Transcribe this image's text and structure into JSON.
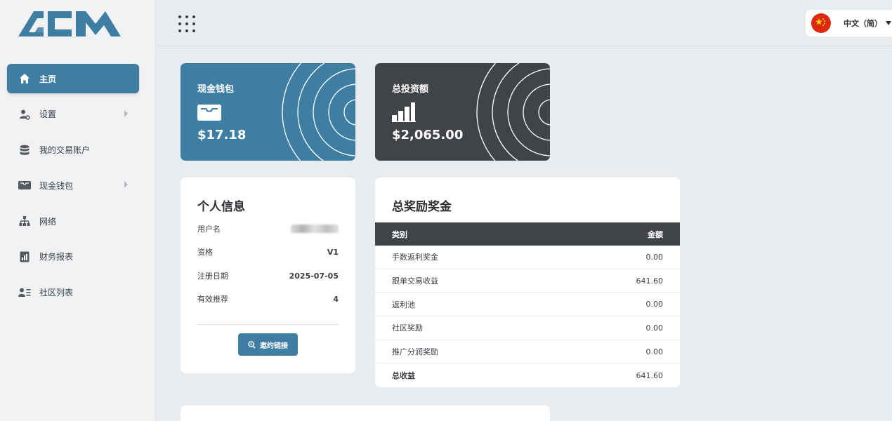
{
  "brand": {
    "logo_text": "ACM"
  },
  "sidebar": {
    "items": [
      {
        "label": "主页",
        "icon": "home-icon",
        "active": true,
        "submenu": false
      },
      {
        "label": "设置",
        "icon": "user-gear-icon",
        "active": false,
        "submenu": true
      },
      {
        "label": "我的交易账户",
        "icon": "database-icon",
        "active": false,
        "submenu": false
      },
      {
        "label": "现金钱包",
        "icon": "wallet-icon",
        "active": false,
        "submenu": true
      },
      {
        "label": "网络",
        "icon": "network-icon",
        "active": false,
        "submenu": false
      },
      {
        "label": "财务报表",
        "icon": "report-icon",
        "active": false,
        "submenu": false
      },
      {
        "label": "社区列表",
        "icon": "contact-list-icon",
        "active": false,
        "submenu": false
      }
    ]
  },
  "header": {
    "apps_icon": "grid-dots-icon",
    "language": {
      "label": "中文（简）",
      "flag": "china-flag-icon"
    }
  },
  "cards": {
    "cash_wallet": {
      "title": "现金钱包",
      "value": "$17.18",
      "icon": "wallet-icon",
      "color": "#3e7ea3"
    },
    "total_investment": {
      "title": "总投资额",
      "value": "$2,065.00",
      "icon": "bar-chart-icon",
      "color": "#404347"
    }
  },
  "profile": {
    "title": "个人信息",
    "rows": [
      {
        "label": "用户名",
        "value": ""
      },
      {
        "label": "资格",
        "value": "V1"
      },
      {
        "label": "注册日期",
        "value": "2025-07-05"
      },
      {
        "label": "有效推荐",
        "value": "4"
      }
    ],
    "invite_button": "邀约链接"
  },
  "bonus": {
    "title": "总奖励奖金",
    "headers": {
      "type": "类别",
      "amount": "金额"
    },
    "rows": [
      {
        "label": "手数返利奖金",
        "amount": "0.00"
      },
      {
        "label": "跟单交易收益",
        "amount": "641.60"
      },
      {
        "label": "返利池",
        "amount": "0.00"
      },
      {
        "label": "社区奖励",
        "amount": "0.00"
      },
      {
        "label": "推广分润奖励",
        "amount": "0.00"
      },
      {
        "label": "总收益",
        "amount": "641.60"
      }
    ]
  },
  "colors": {
    "accent": "#3e7ea3",
    "dark": "#404347",
    "background": "#e9ecef"
  }
}
